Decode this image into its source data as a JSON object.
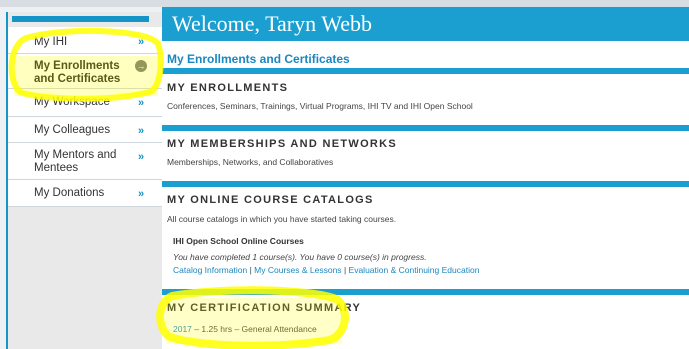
{
  "colors": {
    "accent": "#1b9fd0",
    "link": "#1b87c0",
    "highlight": "#ffff00"
  },
  "sidebar": {
    "items": [
      {
        "label": "My IHI",
        "icon": "chevron-right-icon",
        "glyph": "»"
      },
      {
        "label": "My Enrollments and Certificates",
        "icon": "arrow-circle-icon",
        "glyph": "→",
        "active": true
      },
      {
        "label": "My Workspace",
        "icon": "chevron-right-icon",
        "glyph": "»"
      },
      {
        "label": "My Colleagues",
        "icon": "chevron-right-icon",
        "glyph": "»"
      },
      {
        "label": "My Mentors and Mentees",
        "icon": "chevron-right-icon",
        "glyph": "»"
      },
      {
        "label": "My Donations",
        "icon": "chevron-right-icon",
        "glyph": "»"
      }
    ]
  },
  "header": {
    "title": "Welcome, Taryn Webb"
  },
  "main": {
    "section_title": "My Enrollments and Certificates",
    "enrollments": {
      "heading": "MY ENROLLMENTS",
      "description": "Conferences, Seminars, Trainings, Virtual Programs, IHI TV and IHI Open School"
    },
    "memberships": {
      "heading": "MY MEMBERSHIPS AND NETWORKS",
      "description": "Memberships, Networks, and Collaboratives"
    },
    "catalogs": {
      "heading": "MY ONLINE COURSE CATALOGS",
      "description": "All course catalogs in which you have started taking courses.",
      "course_name": "IHI Open School Online Courses",
      "status": "You have completed 1 course(s). You have 0 course(s) in progress.",
      "links": [
        "Catalog Information",
        "My Courses & Lessons",
        "Evaluation & Continuing Education"
      ],
      "separator": "|"
    },
    "certification": {
      "heading": "MY CERTIFICATION SUMMARY",
      "year": "2017",
      "detail": " – 1.25 hrs – General Attendance"
    }
  }
}
